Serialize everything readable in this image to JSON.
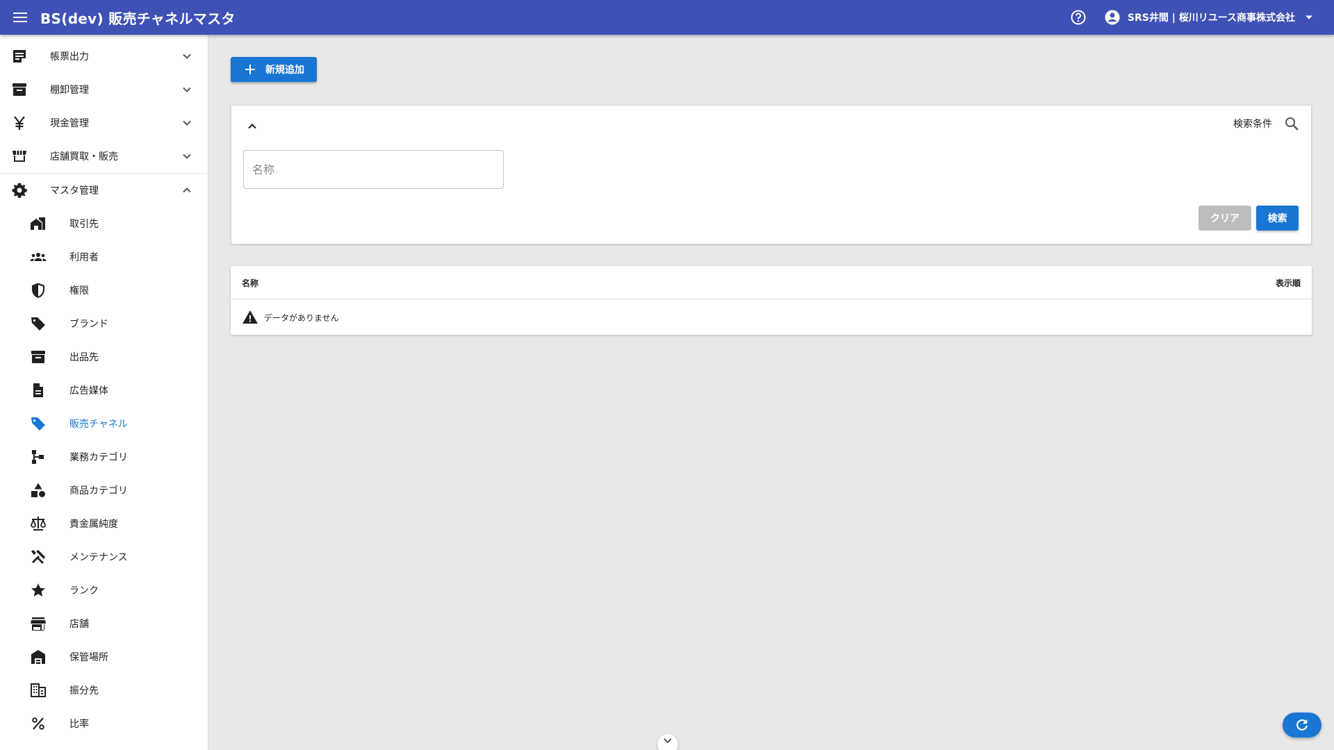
{
  "header": {
    "title": "BS(dev) 販売チャネルマスタ",
    "user": "SRS井間 | 桜川リユース商事株式会社",
    "icons": {
      "menu": "menu-icon",
      "help": "help-circle-icon",
      "account": "account-circle-icon",
      "caret": "caret-down-icon"
    }
  },
  "sidebar": {
    "groups": [
      {
        "label": "帳票出力",
        "icon": "note-icon",
        "expanded": false
      },
      {
        "label": "棚卸管理",
        "icon": "archive-icon",
        "expanded": false
      },
      {
        "label": "現金管理",
        "icon": "yen-icon",
        "expanded": false
      },
      {
        "label": "店舗買取・販売",
        "icon": "storefront-icon",
        "expanded": false
      },
      {
        "label": "マスタ管理",
        "icon": "gear-icon",
        "expanded": true
      }
    ],
    "items": [
      {
        "label": "取引先",
        "icon": "partner-home-icon"
      },
      {
        "label": "利用者",
        "icon": "group-icon"
      },
      {
        "label": "権限",
        "icon": "shield-icon"
      },
      {
        "label": "ブランド",
        "icon": "tag-icon"
      },
      {
        "label": "出品先",
        "icon": "archive-icon"
      },
      {
        "label": "広告媒体",
        "icon": "document-icon"
      },
      {
        "label": "販売チャネル",
        "icon": "tag-icon",
        "active": true
      },
      {
        "label": "業務カテゴリ",
        "icon": "hierarchy-icon"
      },
      {
        "label": "商品カテゴリ",
        "icon": "shapes-icon"
      },
      {
        "label": "貴金属純度",
        "icon": "balance-scale-icon"
      },
      {
        "label": "メンテナンス",
        "icon": "tools-icon"
      },
      {
        "label": "ランク",
        "icon": "star-icon"
      },
      {
        "label": "店舗",
        "icon": "store-icon"
      },
      {
        "label": "保管場所",
        "icon": "warehouse-icon"
      },
      {
        "label": "振分先",
        "icon": "building-icon"
      },
      {
        "label": "比率",
        "icon": "percent-icon"
      }
    ]
  },
  "toolbar": {
    "add_label": "新規追加"
  },
  "search": {
    "title": "検索条件",
    "name_placeholder": "名称",
    "clear_label": "クリア",
    "search_label": "検索"
  },
  "table": {
    "columns": [
      "名称",
      "表示順"
    ],
    "empty_text": "データがありません"
  },
  "colors": {
    "appbar": "#3f51b5",
    "primary": "#1976d2",
    "disabled": "#bdbdbd",
    "background": "#e8e8e8"
  }
}
